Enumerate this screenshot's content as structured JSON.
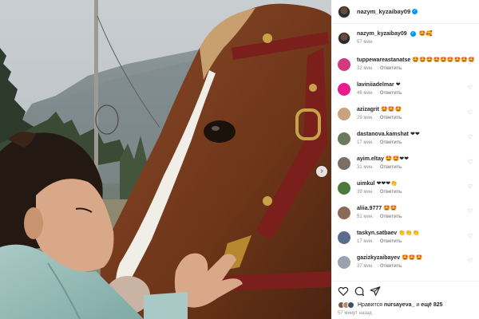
{
  "post": {
    "owner": "nazym_kyzaibay09",
    "caption_user": "nazym_kyzaibay09",
    "caption_text": "🤩🥰",
    "caption_time": "57 мин."
  },
  "comments": [
    {
      "user": "tuppewareastanatse",
      "text": "🤩🤩🤩🤩🤩🤩🤩🤩🤩",
      "time": "32 мин.",
      "reply": "Ответить",
      "avatar_color": "#d23b7b"
    },
    {
      "user": "laviniiadelmar",
      "text": "❤",
      "time": "46 мин.",
      "reply": "Ответить",
      "avatar_color": "#e91e8c"
    },
    {
      "user": "azizagrit",
      "text": "🤩🤩🤩",
      "time": "29 мин.",
      "reply": "Ответить",
      "avatar_color": "#c9a27e"
    },
    {
      "user": "dastanova.kamshat",
      "text": "❤❤",
      "time": "17 мин.",
      "reply": "Ответить",
      "avatar_color": "#6b7a5a"
    },
    {
      "user": "ayim.eltay",
      "text": "🤩🤩❤❤",
      "time": "31 мин.",
      "reply": "Ответить",
      "avatar_color": "#7a6f66"
    },
    {
      "user": "uimkul",
      "text": "❤❤❤👏",
      "time": "39 мин.",
      "reply": "Ответить",
      "avatar_color": "#4c7a3c"
    },
    {
      "user": "aliia.9777",
      "text": "🤩🤩",
      "time": "51 мин.",
      "reply": "Ответить",
      "avatar_color": "#8b6a58"
    },
    {
      "user": "taskyn.satbaev",
      "text": "👏👏👏",
      "time": "17 мин.",
      "reply": "Ответить",
      "avatar_color": "#5a6e8c"
    },
    {
      "user": "gazizkyzaibayev",
      "text": "🤩🤩🤩",
      "time": "37 мин.",
      "reply": "Ответить",
      "avatar_color": "#9aa3ad"
    }
  ],
  "likes": {
    "prefix": "Нравится",
    "user": "nursayeva_",
    "suffix": "и",
    "count_text": "ещё 825"
  },
  "time_ago": "57 минут назад",
  "icons": {
    "like": "heart-icon",
    "comment": "comment-icon",
    "share": "share-icon",
    "next": "chevron-right-icon"
  },
  "colors": {
    "verified": "#0095f6",
    "muted": "#8e8e8e",
    "text": "#262626"
  }
}
